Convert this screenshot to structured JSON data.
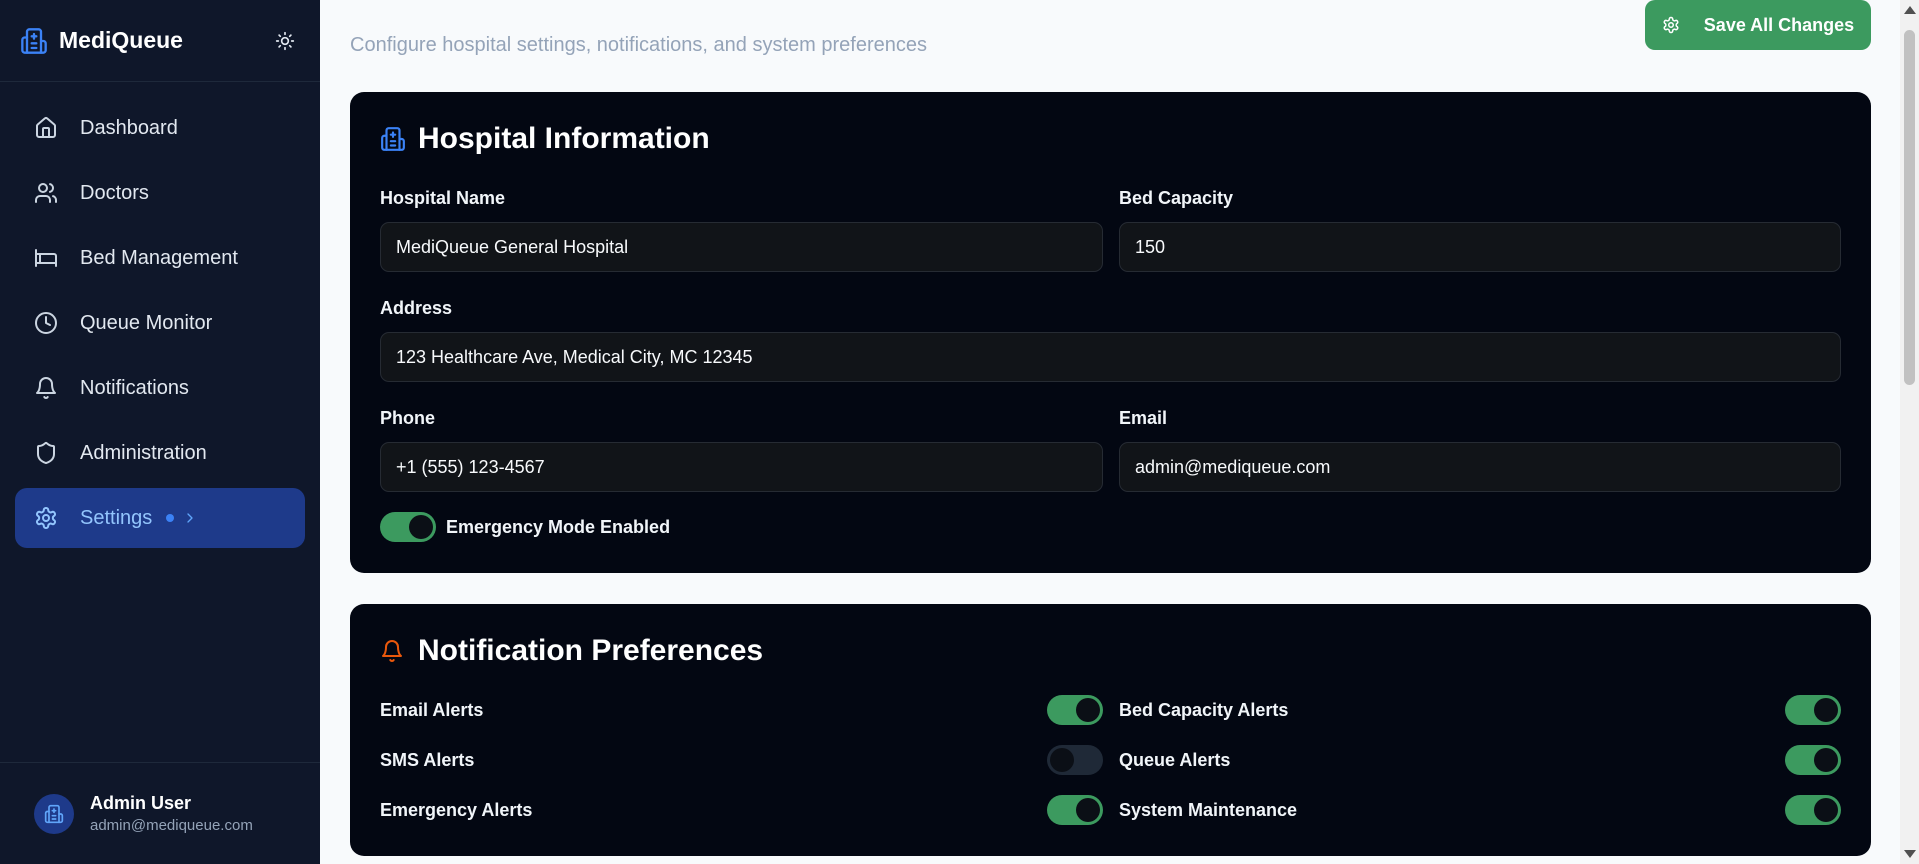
{
  "app": {
    "name": "MediQueue"
  },
  "sidebar": {
    "items": [
      {
        "label": "Dashboard",
        "icon": "home-icon"
      },
      {
        "label": "Doctors",
        "icon": "users-icon"
      },
      {
        "label": "Bed Management",
        "icon": "bed-icon"
      },
      {
        "label": "Queue Monitor",
        "icon": "clock-icon"
      },
      {
        "label": "Notifications",
        "icon": "bell-icon"
      },
      {
        "label": "Administration",
        "icon": "shield-icon"
      },
      {
        "label": "Settings",
        "icon": "gear-icon",
        "active": true
      }
    ]
  },
  "user": {
    "name": "Admin User",
    "email": "admin@mediqueue.com"
  },
  "header": {
    "subtitle": "Configure hospital settings, notifications, and system preferences",
    "save_label": "Save All Changes"
  },
  "hospital": {
    "title": "Hospital Information",
    "name_label": "Hospital Name",
    "name_value": "MediQueue General Hospital",
    "capacity_label": "Bed Capacity",
    "capacity_value": "150",
    "address_label": "Address",
    "address_value": "123 Healthcare Ave, Medical City, MC 12345",
    "phone_label": "Phone",
    "phone_value": "+1 (555) 123-4567",
    "email_label": "Email",
    "email_value": "admin@mediqueue.com",
    "emergency_label": "Emergency Mode Enabled",
    "emergency_on": true
  },
  "notifications": {
    "title": "Notification Preferences",
    "items": [
      {
        "label": "Email Alerts",
        "on": true
      },
      {
        "label": "Bed Capacity Alerts",
        "on": true
      },
      {
        "label": "SMS Alerts",
        "on": false
      },
      {
        "label": "Queue Alerts",
        "on": true
      },
      {
        "label": "Emergency Alerts",
        "on": true
      },
      {
        "label": "System Maintenance",
        "on": true
      }
    ]
  },
  "colors": {
    "accent": "#3b82f6",
    "success": "#3c9a5f",
    "sidebar_bg": "#0f172a",
    "card_bg": "#030712",
    "bell_accent": "#ea580c"
  }
}
